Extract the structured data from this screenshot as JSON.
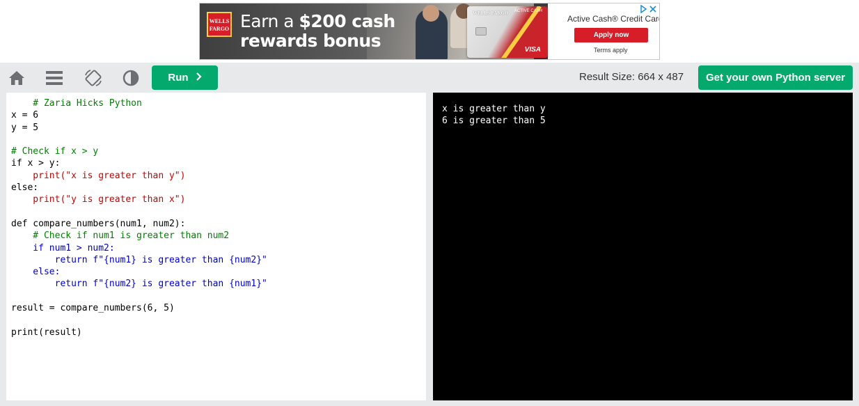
{
  "ad": {
    "logo_text": "WELLS FARGO",
    "headline_prefix": "Earn a ",
    "headline_amount": "$200 cash",
    "headline_line2": "rewards bonus",
    "card_brand": "WELLS FARGO",
    "card_active": "ACTIVE CASH",
    "card_network": "VISA",
    "product": "Active Cash® Credit Card",
    "apply_label": "Apply now",
    "terms_label": "Terms apply",
    "choices_icon": "ad-choices-icon"
  },
  "toolbar": {
    "home_icon": "home-icon",
    "menu_icon": "menu-icon",
    "rotate_icon": "rotate-icon",
    "contrast_icon": "contrast-icon",
    "run_label": "Run",
    "run_chevron": "›",
    "result_size": "Result Size: 664 x 487",
    "server_label": "Get your own Python server"
  },
  "editor": {
    "lines": [
      "    # Zaria Hicks Python",
      "x = 6",
      "y = 5",
      "",
      "# Check if x > y",
      "if x > y:",
      "    print(\"x is greater than y\")",
      "else:",
      "    print(\"y is greater than x\")",
      "",
      "def compare_numbers(num1, num2):",
      "    # Check if num1 is greater than num2",
      "    if num1 > num2:",
      "        return f\"{num1} is greater than {num2}\"",
      "    else:",
      "        return f\"{num2} is greater than {num1}\"",
      "",
      "result = compare_numbers(6, 5)",
      "",
      "print(result)"
    ]
  },
  "output": {
    "lines": [
      "x is greater than y",
      "6 is greater than 5"
    ]
  },
  "colors": {
    "accent": "#04aa6d",
    "toolbar_bg": "#e7e9eb",
    "output_bg": "#000000"
  }
}
